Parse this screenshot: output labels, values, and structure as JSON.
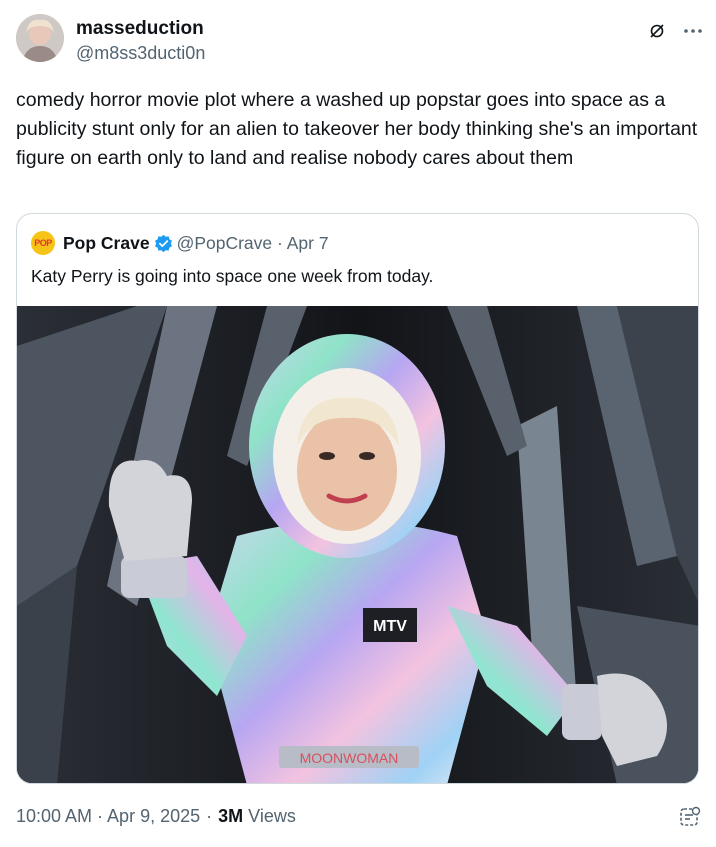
{
  "author": {
    "display_name": "masseduction",
    "handle": "@m8ss3ducti0n"
  },
  "top_icons": {
    "grok": "grok-icon",
    "more": "more-icon",
    "more_glyph": "···"
  },
  "tweet": {
    "text": "comedy horror movie plot where a washed up popstar goes into space as a publicity stunt only for an alien to takeover her body thinking she's an important figure on earth only to land and realise nobody cares about them"
  },
  "quote": {
    "logo_text": "POP",
    "display_name": "Pop Crave",
    "verified": true,
    "handle_date": "@PopCrave · Apr 7",
    "text": "Katy Perry is going into space one week from today.",
    "image_belt_text": "MOONWOMAN",
    "image_chest_text": "MTV"
  },
  "footer": {
    "time_date": "10:00 AM · Apr 9, 2025",
    "separator": "·",
    "views_count": "3M",
    "views_label": "Views"
  },
  "colors": {
    "text_primary": "#0f1419",
    "text_secondary": "#536471",
    "border": "#cfd9de",
    "verified_blue": "#1d9bf0",
    "pop_crave_yellow": "#f6c417"
  }
}
